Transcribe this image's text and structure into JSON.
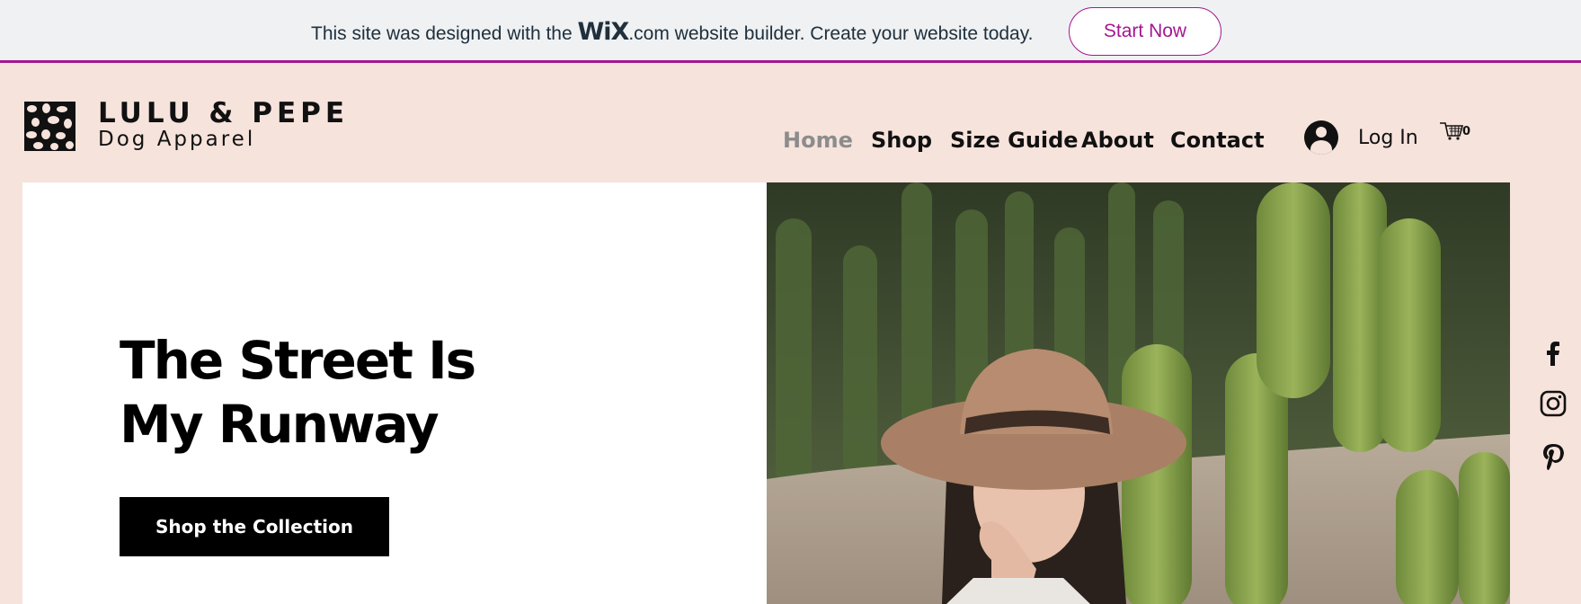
{
  "banner": {
    "text_before": "This site was designed with the ",
    "wix_logo": "WiX",
    "text_after": ".com website builder. Create your website today.",
    "cta_label": "Start Now"
  },
  "brand": {
    "name": "LULU & PEPE",
    "tagline": "Dog Apparel"
  },
  "nav": {
    "items": [
      {
        "label": "Home",
        "active": true
      },
      {
        "label": "Shop",
        "active": false
      },
      {
        "label": "Size Guide",
        "active": false
      },
      {
        "label": "About",
        "active": false
      },
      {
        "label": "Contact",
        "active": false
      }
    ]
  },
  "account": {
    "login_label": "Log In",
    "cart_count": "0"
  },
  "hero": {
    "headline_line1": "The Street Is",
    "headline_line2": "My Runway",
    "cta_label": "Shop the Collection"
  },
  "social": [
    "facebook-icon",
    "instagram-icon",
    "pinterest-icon"
  ],
  "colors": {
    "accent": "#a4178f",
    "page_bg": "#f6e3dc",
    "banner_bg": "#eff1f3",
    "nav_active": "#8c8c8c"
  }
}
